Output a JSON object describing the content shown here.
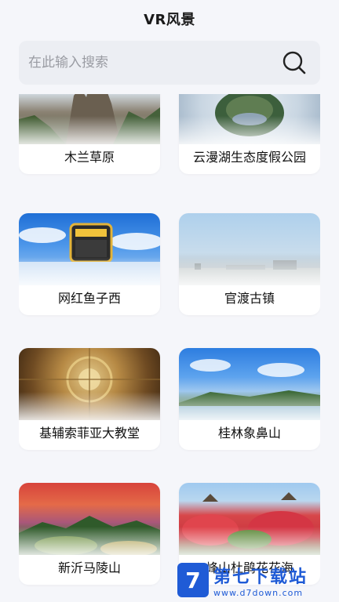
{
  "header": {
    "title": "VR风景"
  },
  "search": {
    "placeholder": "在此输入搜索"
  },
  "cards": [
    {
      "label": "木兰草原"
    },
    {
      "label": "云漫湖生态度假公园"
    },
    {
      "label": "网红鱼子西"
    },
    {
      "label": "官渡古镇"
    },
    {
      "label": "基辅索菲亚大教堂"
    },
    {
      "label": "桂林象鼻山"
    },
    {
      "label": "新沂马陵山"
    },
    {
      "label": "峰山杜鹃花花海"
    }
  ],
  "watermark": {
    "logo": "7",
    "main": "第七下载站",
    "sub": "www.d7down.com"
  }
}
